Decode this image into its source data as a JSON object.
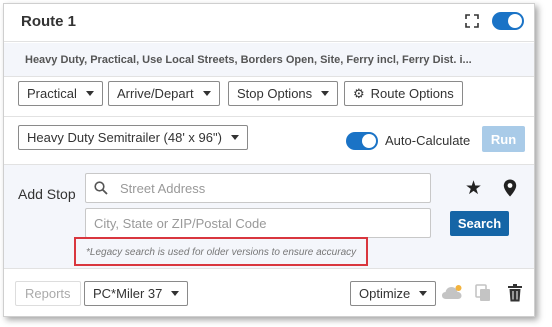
{
  "route": {
    "title": "Route 1",
    "summary": "Heavy Duty, Practical, Use Local Streets, Borders Open, Site, Ferry incl, Ferry Dist. i..."
  },
  "toolbar": {
    "practical_label": "Practical",
    "arrive_depart_label": "Arrive/Depart",
    "stop_options_label": "Stop Options",
    "route_options_label": "Route Options"
  },
  "vehicle": {
    "profile_label": "Heavy Duty Semitrailer (48' x 96\")",
    "auto_calculate_label": "Auto-Calculate",
    "run_label": "Run"
  },
  "add_stop": {
    "label": "Add Stop",
    "street_placeholder": "Street Address",
    "city_placeholder": "City, State or ZIP/Postal Code",
    "search_label": "Search",
    "legacy_note": "*Legacy search is used for older versions to ensure accuracy"
  },
  "footer": {
    "reports_label": "Reports",
    "version_label": "PC*Miler 37",
    "optimize_label": "Optimize"
  },
  "colors": {
    "accent": "#1a73c6",
    "search_button": "#1565a6",
    "run_disabled": "#a9cbe8",
    "highlight_box": "#d9363e"
  }
}
